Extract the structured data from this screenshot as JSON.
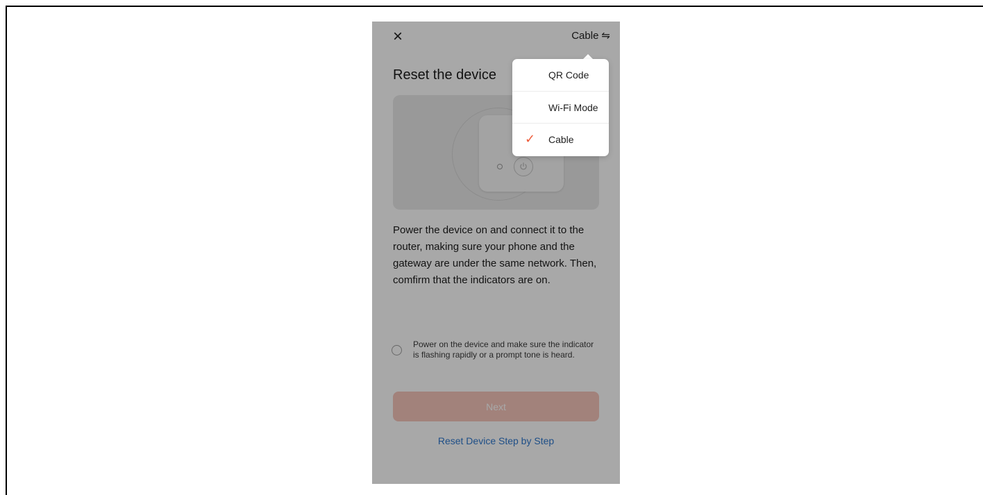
{
  "screen": {
    "close_label": "×",
    "mode_switch": {
      "label": "Cable",
      "icon": "swap-icon"
    },
    "page_title": "Reset the device",
    "instructions": "Power the device on and connect it to the router, making sure your phone and the gateway are under the same network. Then, comfirm that the indicators are on.",
    "confirm_text": "Power on the device and make sure the indicator is flashing rapidly or a prompt tone is heard.",
    "next_button": "Next",
    "reset_link": "Reset Device Step by Step"
  },
  "menu": {
    "items": [
      {
        "label": "QR Code"
      },
      {
        "label": "Wi-Fi Mode"
      },
      {
        "label": "Cable",
        "selected": true
      }
    ]
  },
  "colors": {
    "accent": "#ee5c3a",
    "next_button": "#f6c5bb",
    "link": "#2f78ce"
  }
}
